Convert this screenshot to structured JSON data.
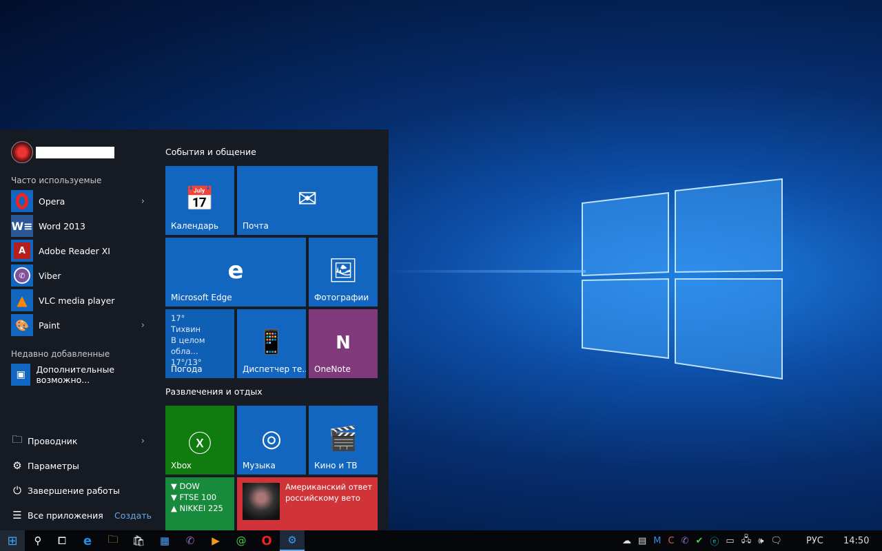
{
  "start_menu": {
    "most_used_label": "Часто используемые",
    "recent_label": "Недавно добавленные",
    "apps": [
      {
        "label": "Opera",
        "icon": "opera-icon",
        "has_submenu": true
      },
      {
        "label": "Word 2013",
        "icon": "word-icon",
        "has_submenu": false
      },
      {
        "label": "Adobe Reader XI",
        "icon": "adobe-reader-icon",
        "has_submenu": false
      },
      {
        "label": "Viber",
        "icon": "viber-icon",
        "has_submenu": false
      },
      {
        "label": "VLC media player",
        "icon": "vlc-icon",
        "has_submenu": false
      },
      {
        "label": "Paint",
        "icon": "paint-icon",
        "has_submenu": true
      }
    ],
    "recent": [
      {
        "label": "Дополнительные возможно...",
        "icon": "app-icon"
      }
    ],
    "system": {
      "explorer": "Проводник",
      "settings": "Параметры",
      "shutdown": "Завершение работы",
      "all_apps": "Все приложения",
      "create": "Создать"
    }
  },
  "tiles": {
    "group1": "События и общение",
    "group2": "Развлечения и отдых",
    "calendar": "Календарь",
    "mail": "Почта",
    "edge": "Microsoft Edge",
    "photos": "Фотографии",
    "weather": {
      "temp": "17°",
      "city": "Тихвин",
      "cond": "В целом обла...",
      "range": "17°/13°",
      "label": "Погода"
    },
    "phone": "Диспетчер те...",
    "onenote": "OneNote",
    "xbox": "Xbox",
    "music": "Музыка",
    "movies": "Кино и ТВ",
    "money": [
      "▼ DOW",
      "▼ FTSE 100",
      "▲ NIKKEI 225"
    ],
    "news": "Американский ответ российскому вето"
  },
  "colors": {
    "tile_blue": "#1366c0",
    "xbox_green": "#107c10",
    "money_green": "#188a3c",
    "onenote_purple": "#80397b",
    "news_red": "#d13438"
  },
  "taskbar": {
    "language": "РУС",
    "time": "14:50"
  }
}
